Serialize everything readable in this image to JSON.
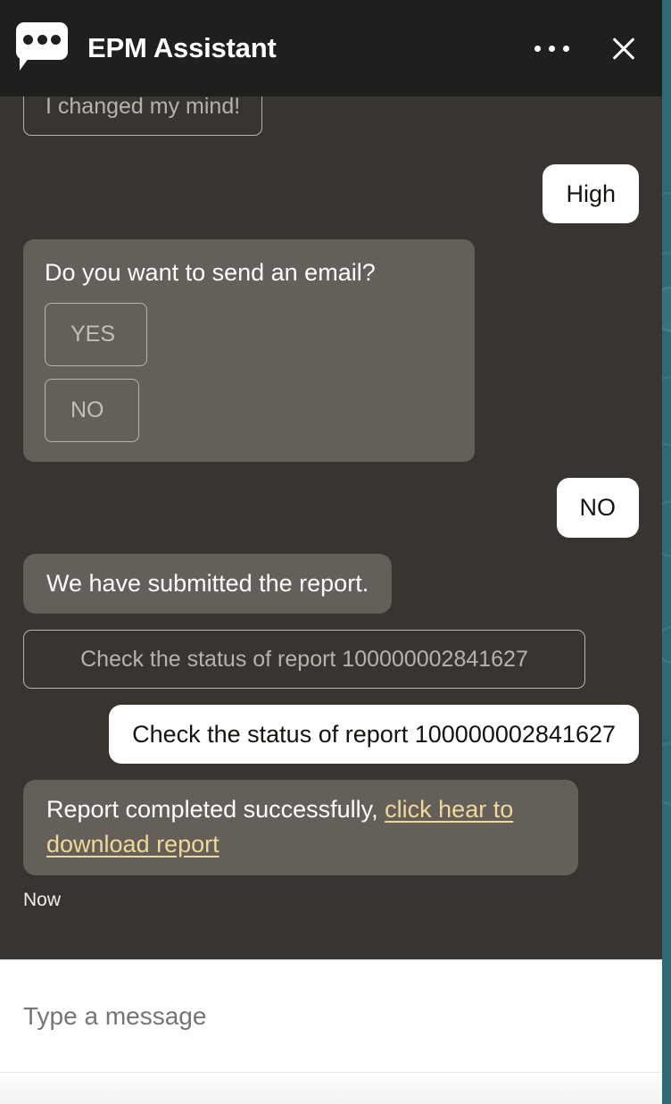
{
  "header": {
    "title": "EPM Assistant",
    "logo_icon": "chat-bubble-dots-icon",
    "more_icon": "ellipsis-icon",
    "close_icon": "close-icon"
  },
  "conversation": [
    {
      "id": "chip-changed-mind",
      "kind": "chip",
      "text": "I changed my mind!"
    },
    {
      "id": "user-high",
      "kind": "user",
      "text": "High"
    },
    {
      "id": "card-send-email",
      "kind": "card",
      "question": "Do you want to send an email?",
      "options": [
        "YES",
        "NO"
      ]
    },
    {
      "id": "user-no",
      "kind": "user",
      "text": "NO"
    },
    {
      "id": "bot-submitted",
      "kind": "bot",
      "text": "We have submitted the report."
    },
    {
      "id": "chip-check-status",
      "kind": "chip",
      "text": "Check the status of report 100000002841627"
    },
    {
      "id": "user-check-status",
      "kind": "user",
      "text": "Check the status of report 100000002841627"
    },
    {
      "id": "bot-completed",
      "kind": "bot",
      "text_before_link": "Report completed successfully, ",
      "link_text": "click hear to download report",
      "link_color": "#efd998"
    }
  ],
  "timestamp": "Now",
  "composer": {
    "placeholder": "Type a message",
    "value": ""
  },
  "colors": {
    "header_bg": "#1f1f1d",
    "chat_bg": "#383430",
    "bot_bubble": "#655f59",
    "user_bubble": "#ffffff",
    "page_bg": "#2d6a74",
    "link": "#efd998",
    "chip_border": "#b9b4ae"
  }
}
